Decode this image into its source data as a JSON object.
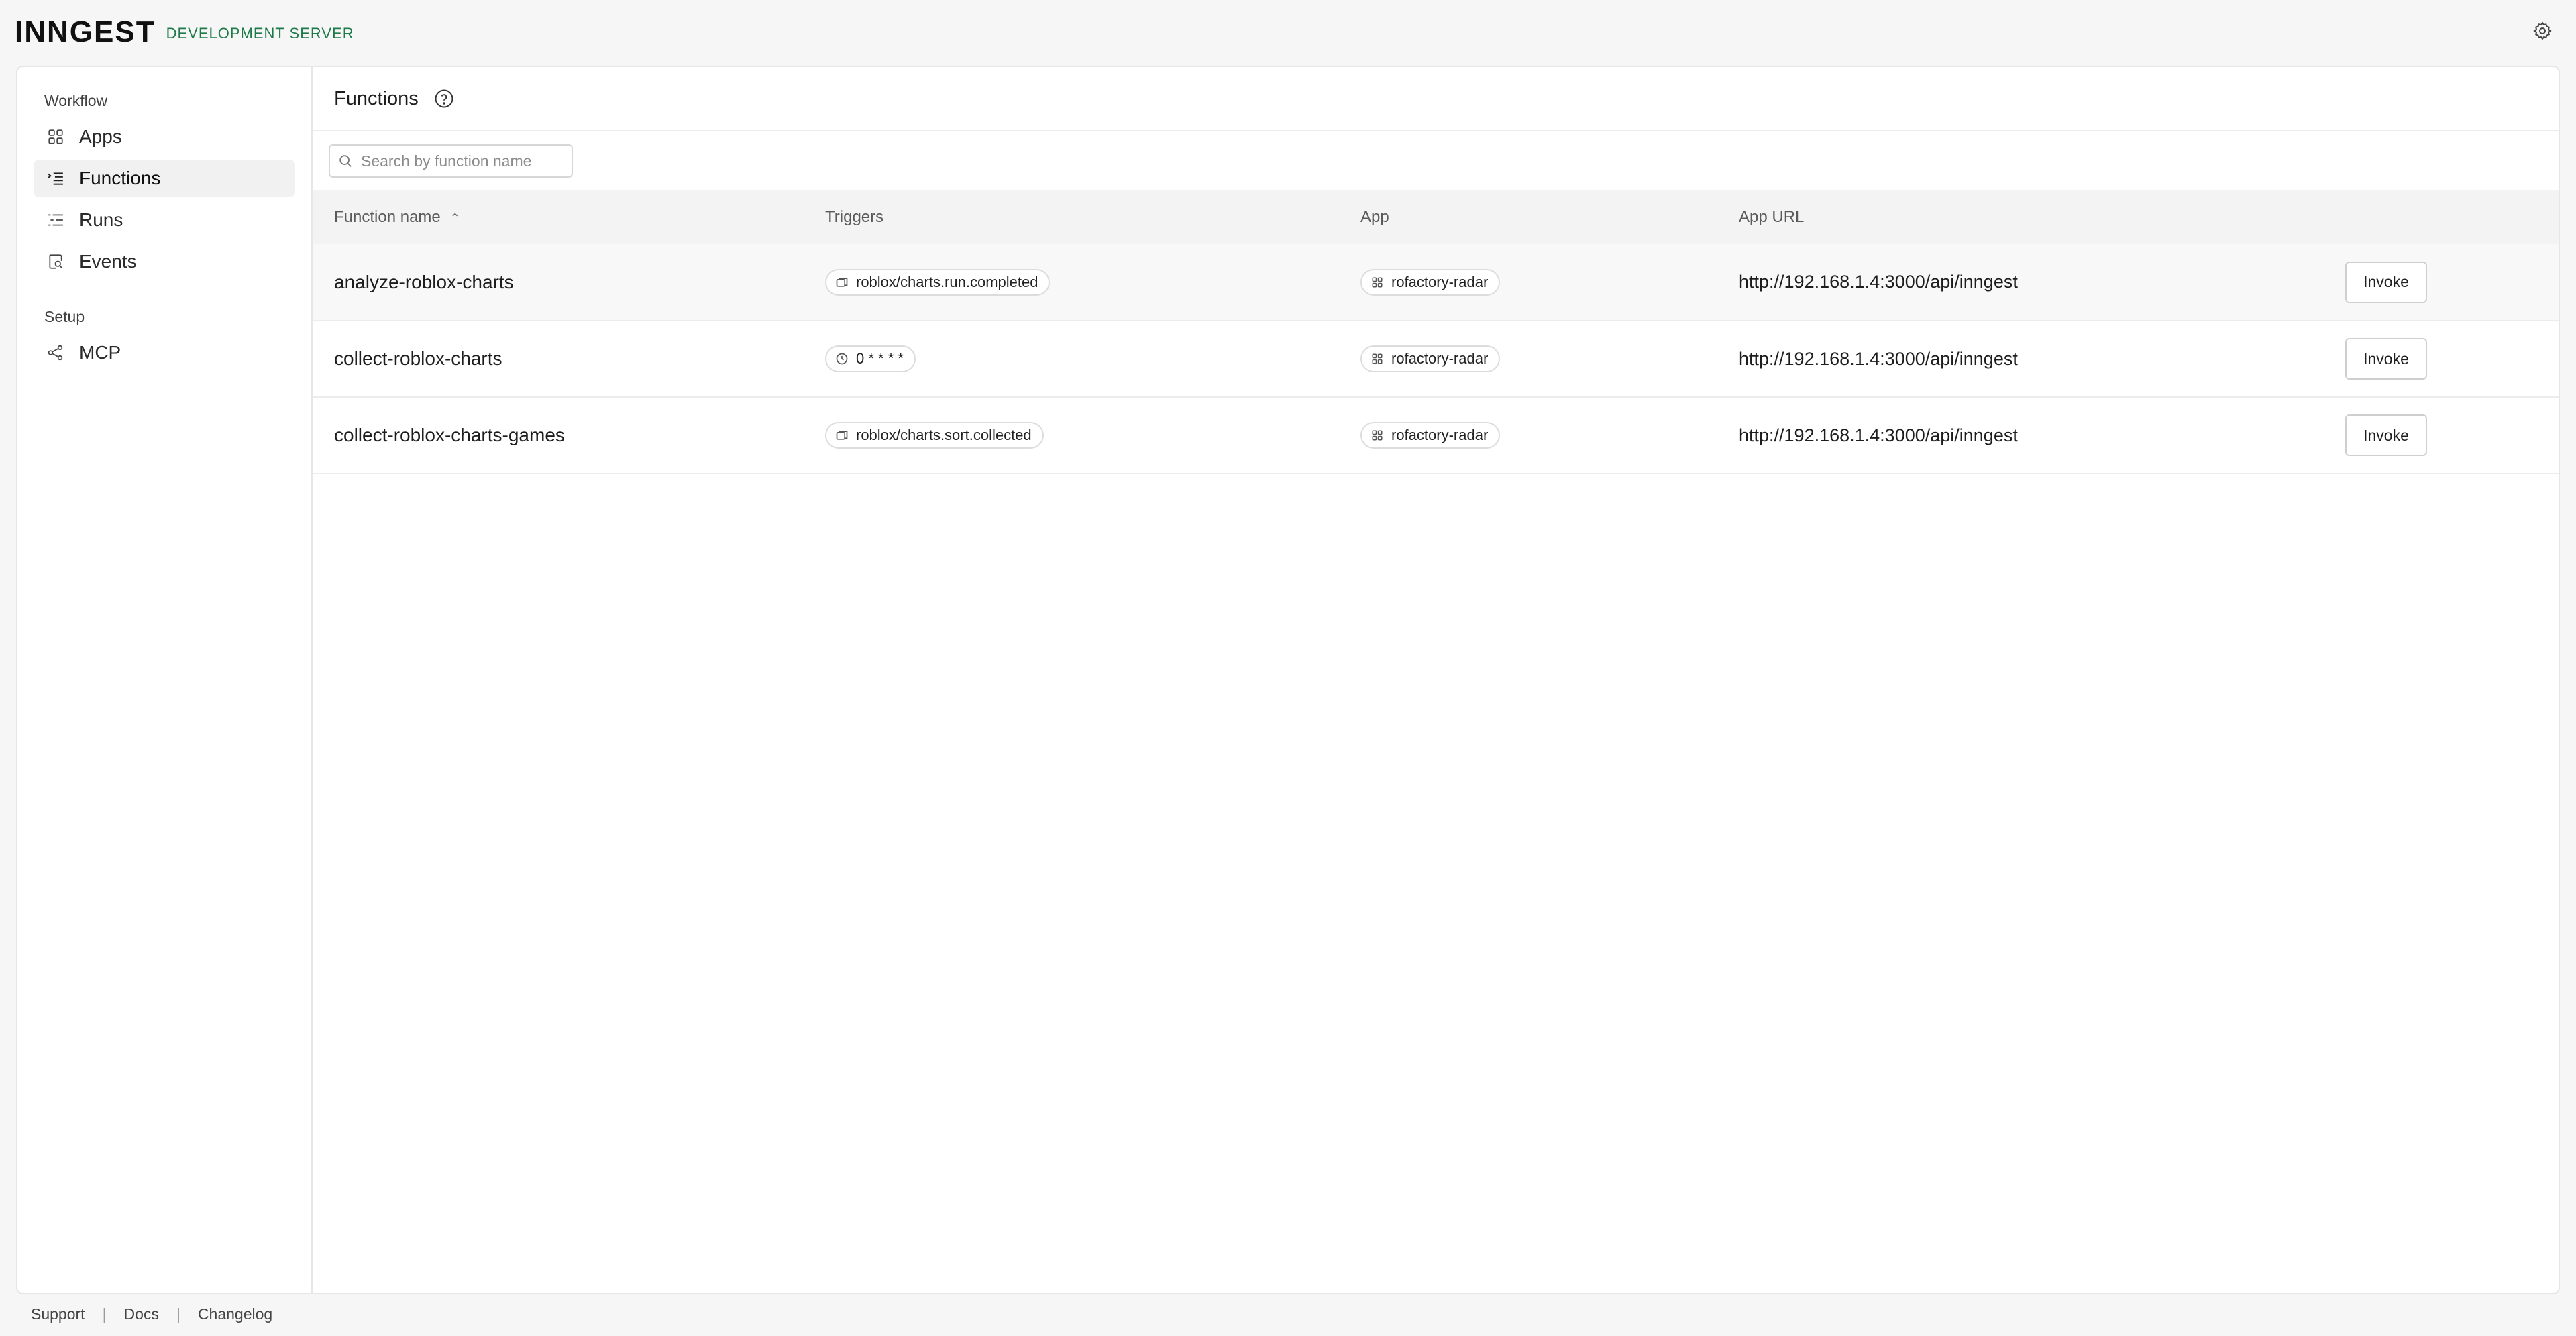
{
  "brand": {
    "logo": "INNGEST",
    "environment": "DEVELOPMENT SERVER"
  },
  "sidebar": {
    "sections": [
      {
        "label": "Workflow",
        "items": [
          {
            "label": "Apps",
            "icon": "apps-grid-icon"
          },
          {
            "label": "Functions",
            "icon": "functions-list-icon",
            "active": true
          },
          {
            "label": "Runs",
            "icon": "runs-list-icon"
          },
          {
            "label": "Events",
            "icon": "events-search-icon"
          }
        ]
      },
      {
        "label": "Setup",
        "items": [
          {
            "label": "MCP",
            "icon": "mcp-share-icon"
          }
        ]
      }
    ]
  },
  "header": {
    "title": "Functions"
  },
  "search": {
    "placeholder": "Search by function name",
    "value": ""
  },
  "table": {
    "columns": [
      "Function name",
      "Triggers",
      "App",
      "App URL"
    ],
    "sort_column": "Function name",
    "sort_direction": "ascending",
    "rows": [
      {
        "name": "analyze-roblox-charts",
        "trigger": "roblox/charts.run.completed",
        "trigger_type": "event",
        "app": "rofactory-radar",
        "url": "http://192.168.1.4:3000/api/inngest",
        "action": "Invoke"
      },
      {
        "name": "collect-roblox-charts",
        "trigger": "0 * * * *",
        "trigger_type": "cron",
        "app": "rofactory-radar",
        "url": "http://192.168.1.4:3000/api/inngest",
        "action": "Invoke"
      },
      {
        "name": "collect-roblox-charts-games",
        "trigger": "roblox/charts.sort.collected",
        "trigger_type": "event",
        "app": "rofactory-radar",
        "url": "http://192.168.1.4:3000/api/inngest",
        "action": "Invoke"
      }
    ]
  },
  "footer": {
    "links": [
      "Support",
      "Docs",
      "Changelog"
    ]
  },
  "colors": {
    "accent_green": "#1f7a4a",
    "background": "#f6f6f6",
    "panel": "#ffffff"
  }
}
